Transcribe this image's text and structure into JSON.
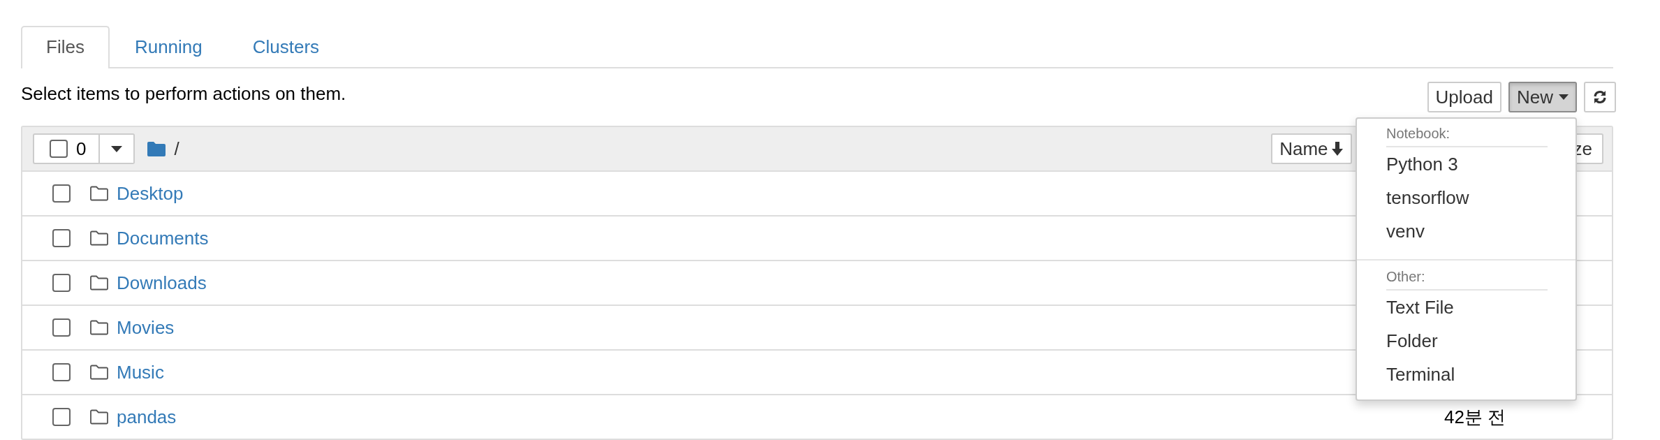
{
  "tabs": [
    {
      "label": "Files",
      "selected": true
    },
    {
      "label": "Running",
      "selected": false
    },
    {
      "label": "Clusters",
      "selected": false
    }
  ],
  "instructions": "Select items to perform actions on them.",
  "toolbar": {
    "buttons": [
      {
        "kind": "text",
        "label": "Upload",
        "pressed": false
      },
      {
        "kind": "dropdown",
        "label": "New",
        "pressed": true
      },
      {
        "kind": "refresh",
        "pressed": false
      }
    ]
  },
  "list_header": {
    "select_all_checked": false,
    "selection_count": "0",
    "path": "/",
    "sort_buttons": [
      {
        "kind": "sorted",
        "label": "Name"
      },
      {
        "kind": "plain",
        "label": "ze"
      }
    ]
  },
  "rows": [
    {
      "name": "Desktop",
      "checked": false
    },
    {
      "name": "Documents",
      "checked": false
    },
    {
      "name": "Downloads",
      "checked": false
    },
    {
      "name": "Movies",
      "checked": false
    },
    {
      "name": "Music",
      "checked": false
    },
    {
      "name": "pandas",
      "checked": false,
      "modified": "42분 전"
    }
  ],
  "new_menu": {
    "sections": [
      {
        "header": "Notebook:",
        "items": [
          "Python 3",
          "tensorflow",
          "venv"
        ]
      },
      {
        "header": "Other:",
        "items": [
          "Text File",
          "Folder",
          "Terminal"
        ]
      }
    ]
  }
}
